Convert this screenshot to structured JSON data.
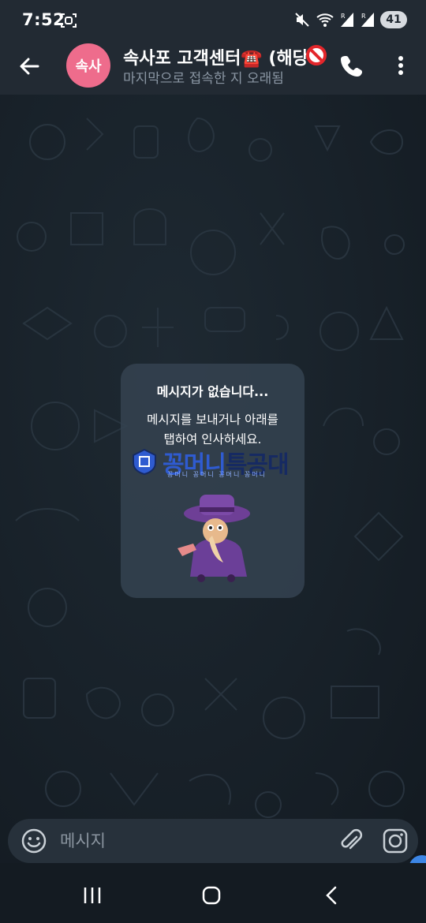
{
  "status_bar": {
    "time": "7:52",
    "battery": "41",
    "icons": [
      "screenshot-icon",
      "mute-icon",
      "wifi-icon",
      "signal-r-icon",
      "signal-icon"
    ]
  },
  "header": {
    "avatar_initials": "속사",
    "avatar_color": "#ee6c8c",
    "title": "속사포 고객센터☎️ (해당",
    "title_trailing_icon": "no-entry-icon",
    "subtitle": "마지막으로 접속한 지 오래됨"
  },
  "empty_state": {
    "title": "메시지가 없습니다...",
    "line1": "메시지를 보내거나 아래를",
    "line2": "탭하여 인사하세요.",
    "sticker": "plague-doctor-sticker"
  },
  "watermark": {
    "brand_a": "꽁머니",
    "brand_b": "특공대",
    "tagline": "꽁머니 꽁머니 꽁머니 꽁머니"
  },
  "composer": {
    "placeholder": "메시지"
  },
  "colors": {
    "header_bg": "#222a33",
    "chat_bg": "#182129",
    "card_bg": "#344250",
    "composer_bg": "#27313b",
    "accent_blue": "#3c86e6"
  }
}
